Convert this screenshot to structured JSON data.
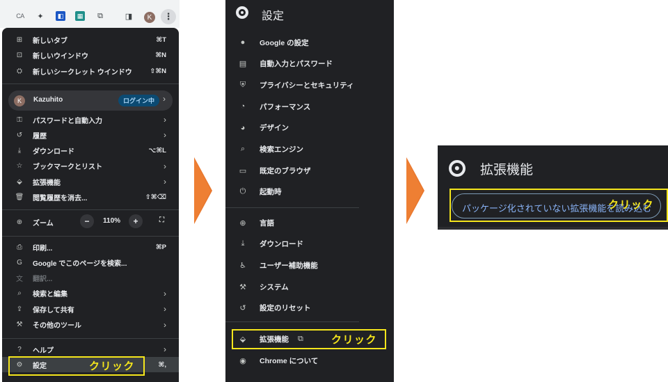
{
  "menu_panel": {
    "toolbar": {
      "ca_label": "CA",
      "avatar_initial": "K"
    },
    "items_top": [
      {
        "label": "新しいタブ",
        "shortcut": "⌘T",
        "icon": "new-tab-icon"
      },
      {
        "label": "新しいウインドウ",
        "shortcut": "⌘N",
        "icon": "new-window-icon"
      },
      {
        "label": "新しいシークレット ウインドウ",
        "shortcut": "⇧⌘N",
        "icon": "incognito-icon"
      }
    ],
    "profile": {
      "initial": "K",
      "name": "Kazuhito",
      "badge": "ログイン中"
    },
    "items_mid": [
      {
        "label": "パスワードと自動入力",
        "icon": "key-icon"
      },
      {
        "label": "履歴",
        "icon": "history-icon"
      },
      {
        "label": "ダウンロード",
        "shortcut": "⌥⌘L",
        "icon": "download-icon"
      },
      {
        "label": "ブックマークとリスト",
        "icon": "star-icon"
      },
      {
        "label": "拡張機能",
        "icon": "extension-icon"
      },
      {
        "label": "閲覧履歴を消去...",
        "shortcut": "⇧⌘⌫",
        "icon": "trash-icon"
      }
    ],
    "zoom": {
      "label": "ズーム",
      "minus": "−",
      "value": "110%",
      "plus": "+"
    },
    "items_lower": [
      {
        "label": "印刷...",
        "shortcut": "⌘P",
        "icon": "print-icon"
      },
      {
        "label": "Google でこのページを検索...",
        "icon": "google-icon"
      },
      {
        "label": "翻訳...",
        "icon": "translate-icon"
      },
      {
        "label": "検索と編集",
        "icon": "search-edit-icon"
      },
      {
        "label": "保存して共有",
        "icon": "save-share-icon"
      },
      {
        "label": "その他のツール",
        "icon": "tools-icon"
      }
    ],
    "help": {
      "label": "ヘルプ"
    },
    "settings": {
      "label": "設定",
      "shortcut": "⌘,",
      "click_label": "クリック"
    }
  },
  "settings_panel": {
    "title": "設定",
    "items_a": [
      {
        "label": "Google の設定",
        "icon": "person-icon"
      },
      {
        "label": "自動入力とパスワード",
        "icon": "clipboard-icon"
      },
      {
        "label": "プライバシーとセキュリティ",
        "icon": "shield-icon"
      },
      {
        "label": "パフォーマンス",
        "icon": "speedometer-icon"
      },
      {
        "label": "デザイン",
        "icon": "palette-icon"
      },
      {
        "label": "検索エンジン",
        "icon": "search-icon"
      },
      {
        "label": "既定のブラウザ",
        "icon": "browser-icon"
      },
      {
        "label": "起動時",
        "icon": "power-icon"
      }
    ],
    "items_b": [
      {
        "label": "言語",
        "icon": "globe-icon"
      },
      {
        "label": "ダウンロード",
        "icon": "download-icon"
      },
      {
        "label": "ユーザー補助機能",
        "icon": "accessibility-icon"
      },
      {
        "label": "システム",
        "icon": "wrench-icon"
      },
      {
        "label": "設定のリセット",
        "icon": "reset-icon"
      }
    ],
    "extensions": {
      "label": "拡張機能",
      "click_label": "クリック"
    },
    "about": {
      "label": "Chrome について"
    }
  },
  "extensions_panel": {
    "title": "拡張機能",
    "button_label": "パッケージ化されていない拡張機能を読み込む",
    "click_label": "クリック"
  },
  "colors": {
    "highlight": "#f5e61c",
    "arrow": "#ee7f33",
    "dark_bg": "#202124",
    "link_blue": "#8ab4f8"
  }
}
